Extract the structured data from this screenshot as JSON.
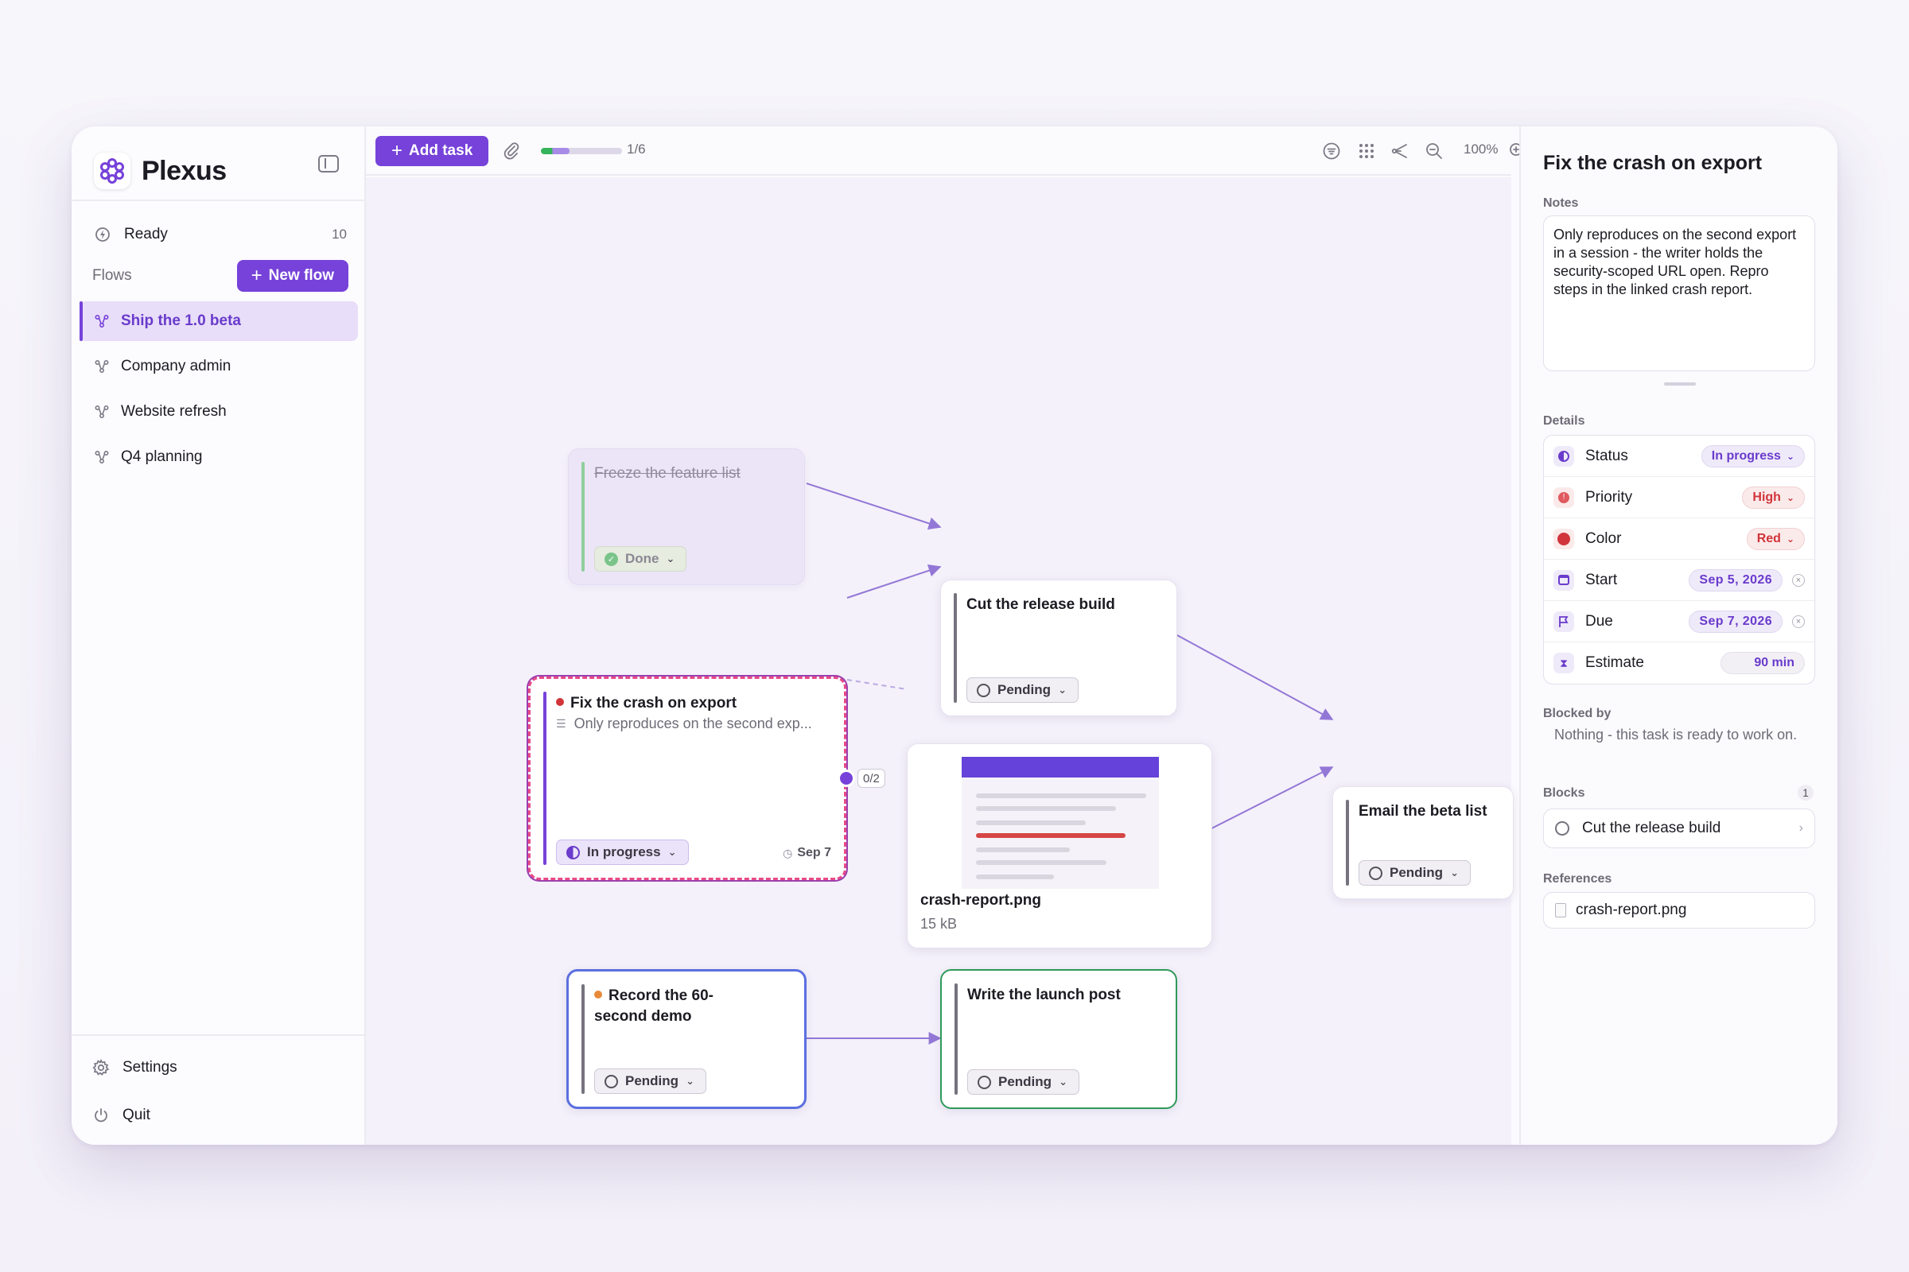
{
  "app": {
    "name": "Plexus"
  },
  "sidebar": {
    "ready": {
      "label": "Ready",
      "count": "10"
    },
    "flows_label": "Flows",
    "new_flow_label": "New flow",
    "items": [
      {
        "label": "Ship the 1.0 beta",
        "active": true
      },
      {
        "label": "Company admin"
      },
      {
        "label": "Website refresh"
      },
      {
        "label": "Q4 planning"
      }
    ],
    "settings_label": "Settings",
    "quit_label": "Quit"
  },
  "toolbar": {
    "add_task_label": "Add task",
    "progress_text": "1/6",
    "progress_fraction": 0.167,
    "zoom_text": "100%"
  },
  "canvas": {
    "cards": {
      "freeze": {
        "title": "Freeze the feature list",
        "status": "Done"
      },
      "cut": {
        "title": "Cut the release build",
        "status": "Pending"
      },
      "fix": {
        "title": "Fix the crash on export",
        "note_preview": "Only reproduces on the second exp...",
        "status": "In progress",
        "due": "Sep 7",
        "connection_badge": "0/2"
      },
      "attachment": {
        "filename": "crash-report.png",
        "size": "15 kB"
      },
      "email": {
        "title": "Email the beta list",
        "status": "Pending"
      },
      "record": {
        "title": "Record the 60-second demo",
        "status": "Pending"
      },
      "launch": {
        "title": "Write the launch post",
        "status": "Pending"
      }
    }
  },
  "inspector": {
    "title": "Fix the crash on export",
    "notes_label": "Notes",
    "notes": "Only reproduces on the second export in a session - the writer holds the security-scoped URL open. Repro steps in the linked crash report.",
    "details_label": "Details",
    "details": {
      "status": {
        "label": "Status",
        "value": "In progress"
      },
      "priority": {
        "label": "Priority",
        "value": "High"
      },
      "color": {
        "label": "Color",
        "value": "Red"
      },
      "start": {
        "label": "Start",
        "value": "Sep 5, 2026"
      },
      "due": {
        "label": "Due",
        "value": "Sep 7, 2026"
      },
      "estimate": {
        "label": "Estimate",
        "value": "90 min"
      }
    },
    "blocked_by_label": "Blocked by",
    "blocked_by_text": "Nothing - this task is ready to work on.",
    "blocks_label": "Blocks",
    "blocks_count": "1",
    "blocks_item": "Cut the release build",
    "references_label": "References",
    "reference_item": "crash-report.png"
  },
  "colors": {
    "accent": "#7642d9",
    "red": "#d1343a",
    "green": "#2f9a5b",
    "blue": "#5b6fe0",
    "orange": "#e8893a"
  }
}
